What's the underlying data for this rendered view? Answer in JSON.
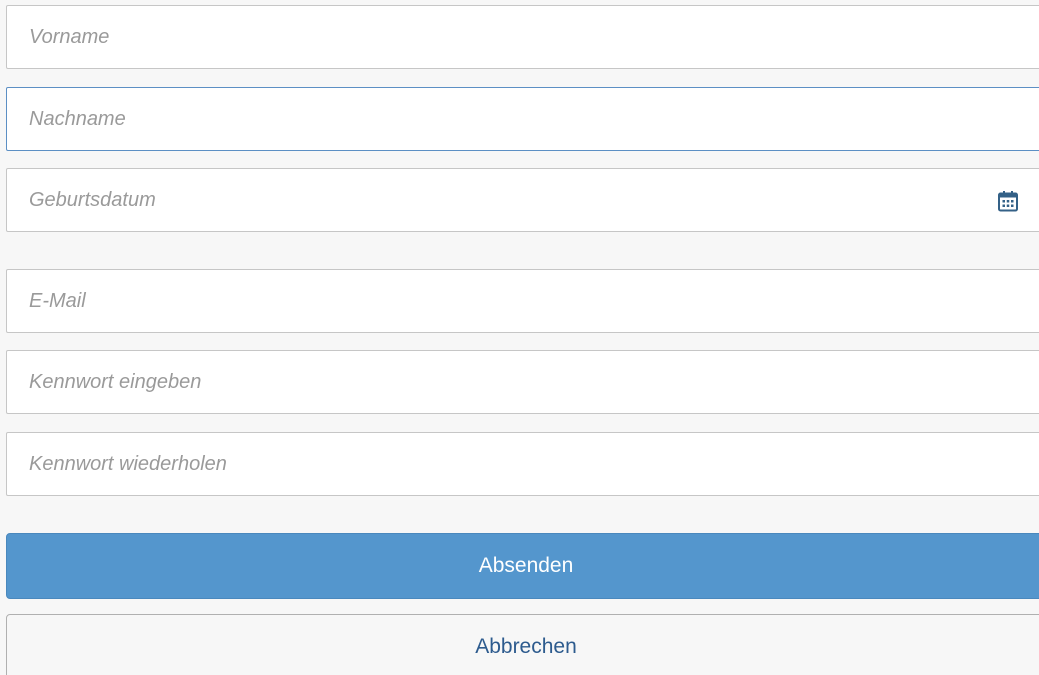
{
  "form": {
    "fields": {
      "firstname": {
        "placeholder": "Vorname",
        "value": ""
      },
      "lastname": {
        "placeholder": "Nachname",
        "value": ""
      },
      "birthdate": {
        "placeholder": "Geburtsdatum",
        "value": "",
        "icon": "calendar-icon"
      },
      "email": {
        "placeholder": "E-Mail",
        "value": ""
      },
      "password": {
        "placeholder": "Kennwort eingeben",
        "value": ""
      },
      "password_repeat": {
        "placeholder": "Kennwort wiederholen",
        "value": ""
      }
    },
    "buttons": {
      "submit_label": "Absenden",
      "cancel_label": "Abbrechen"
    }
  },
  "colors": {
    "primary": "#5496cd",
    "focus_border": "#5c8fc4",
    "secondary_text": "#2d5b8e",
    "placeholder": "#9a9a9a"
  }
}
